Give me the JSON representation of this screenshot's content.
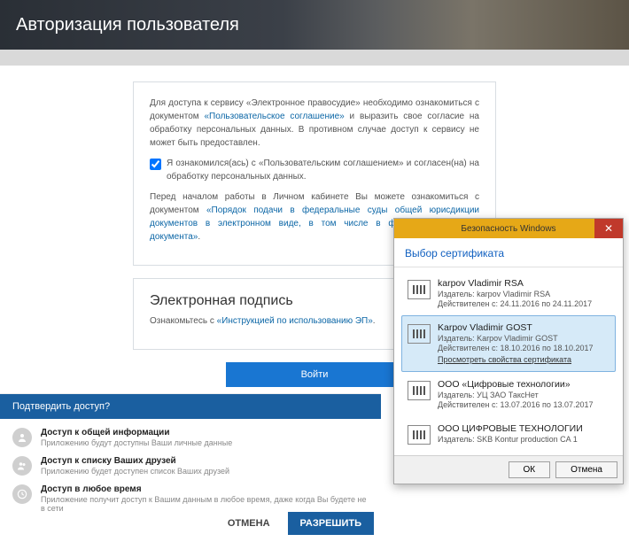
{
  "header": {
    "title": "Авторизация пользователя"
  },
  "intro": {
    "p1a": "Для доступа к сервису «Электронное правосудие» необходимо ознакомиться с документом ",
    "p1link": "«Пользовательское соглашение»",
    "p1b": " и выразить свое согласие на обработку персональных данных. В противном случае доступ к сервису не может быть предоставлен.",
    "chk_label": "Я ознакомился(ась) с «Пользовательским соглашением» и согласен(на) на обработку персональных данных.",
    "p2a": "Перед началом работы в Личном кабинете Вы можете ознакомиться с документом ",
    "p2link": "«Порядок подачи в федеральные суды общей юрисдикции документов в электронном виде, в том числе в форме электронного документа»",
    "p2b": "."
  },
  "ep": {
    "title": "Электронная подпись",
    "hint_a": "Ознакомьтесь с ",
    "hint_link": "«Инструкцией по использованию ЭП»",
    "hint_b": "."
  },
  "login_btn": "Войти",
  "confirm": {
    "heading": "Подтвердить доступ?",
    "perms": [
      {
        "title": "Доступ к общей информации",
        "desc": "Приложению будут доступны Ваши личные данные"
      },
      {
        "title": "Доступ к списку Ваших друзей",
        "desc": "Приложению будет доступен список Ваших друзей"
      },
      {
        "title": "Доступ в любое время",
        "desc": "Приложение получит доступ к Вашим данным в любое время, даже когда Вы будете не в сети"
      }
    ],
    "cancel": "ОТМЕНА",
    "allow": "РАЗРЕШИТЬ"
  },
  "win": {
    "title": "Безопасность Windows",
    "subtitle": "Выбор сертификата",
    "certs": [
      {
        "name": "karpov Vladimir RSA",
        "issuer": "Издатель: karpov Vladimir RSA",
        "valid": "Действителен с: 24.11.2016 по 24.11.2017",
        "link": ""
      },
      {
        "name": "Karpov Vladimir GOST",
        "issuer": "Издатель: Karpov Vladimir GOST",
        "valid": "Действителен с: 18.10.2016 по 18.10.2017",
        "link": "Просмотреть свойства сертификата"
      },
      {
        "name": "ООО «Цифровые технологии»",
        "issuer": "Издатель: УЦ ЗАО ТаксНет",
        "valid": "Действителен с: 13.07.2016 по 13.07.2017",
        "link": ""
      },
      {
        "name": "ООО ЦИФРОВЫЕ ТЕХНОЛОГИИ",
        "issuer": "Издатель: SKB Kontur production CA 1",
        "valid": "",
        "link": ""
      }
    ],
    "ok": "ОК",
    "cancel": "Отмена"
  }
}
